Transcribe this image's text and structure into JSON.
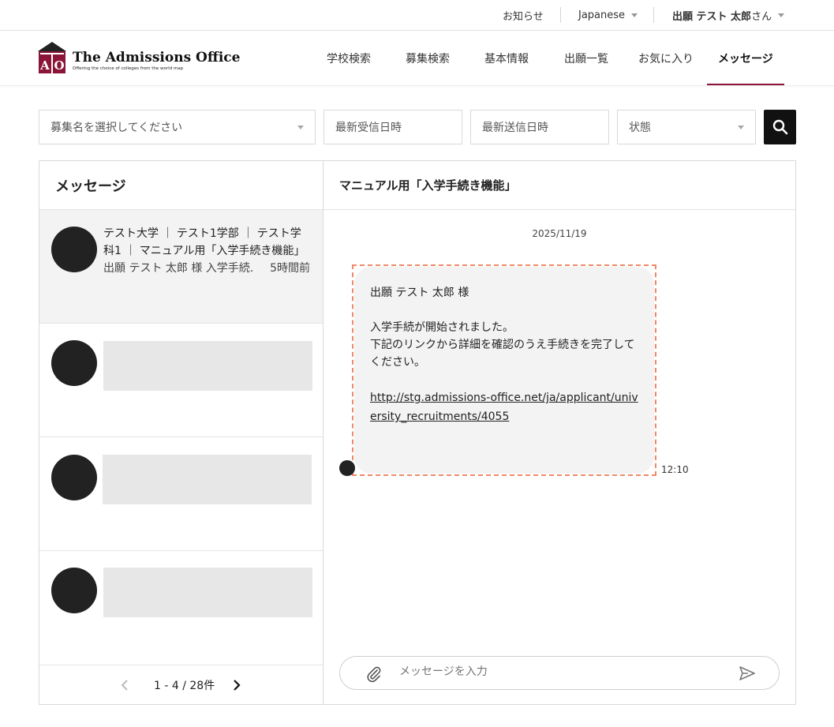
{
  "util_bar": {
    "notice": "お知らせ",
    "language": "Japanese",
    "user_name": "出願 テスト 太郎",
    "user_suffix": "さん"
  },
  "header": {
    "logo_title": "The Admissions Office",
    "logo_tagline": "Offering the choice of colleges from the world map",
    "nav": [
      {
        "label": "学校検索"
      },
      {
        "label": "募集検索"
      },
      {
        "label": "基本情報"
      },
      {
        "label": "出願一覧"
      },
      {
        "label": "お気に入り"
      },
      {
        "label": "メッセージ",
        "active": true
      }
    ]
  },
  "filters": {
    "recruitment": "募集名を選択してください",
    "last_received": "最新受信日時",
    "last_sent": "最新送信日時",
    "status": "状態"
  },
  "left_panel": {
    "title": "メッセージ",
    "active_conversation": {
      "line1": "テスト大学 ｜ テスト1学部 ｜ テスト学",
      "line2": "科1 ｜ マニュアル用「入学手続き機能」",
      "preview": "出願 テスト 太郎 様 入学手続…",
      "time": "5時間前"
    },
    "pagination": "1 - 4 / 28件"
  },
  "right_panel": {
    "title": "マニュアル用「入学手続き機能」",
    "date": "2025/11/19",
    "message": {
      "greeting": "出願 テスト 太郎 様",
      "body1": "入学手続が開始されました。",
      "body2": "下記のリンクから詳細を確認のうえ手続きを完了して",
      "body3": "ください。",
      "link": "http://stg.admissions-office.net/ja/applicant/university_recruitments/4055",
      "time": "12:10"
    },
    "composer_placeholder": "メッセージを入力"
  },
  "colors": {
    "accent": "#8a1538",
    "highlight_outline": "#f08868",
    "bubble_bg": "#f3f3f3"
  }
}
